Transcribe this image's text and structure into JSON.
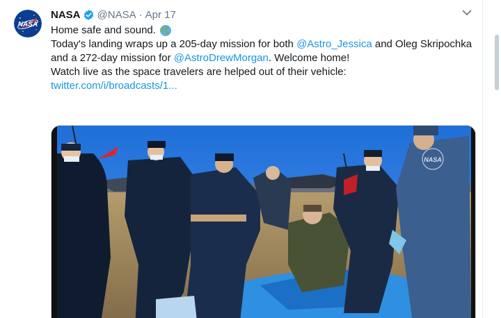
{
  "tweet": {
    "author": {
      "display_name": "NASA",
      "handle": "@NASA",
      "verified": true,
      "avatar_icon": "nasa-meatball-logo"
    },
    "separator": "·",
    "date": "Apr 17",
    "line1": "Home safe and sound.",
    "line1_emoji": "globe-icon",
    "paragraph2": {
      "t1": "Today's landing wraps up a 205-day mission for both ",
      "mention1": "@Astro_Jessica",
      "t2": " and Oleg Skripochka and a 272-day mission for ",
      "mention2": "@AstroDrewMorgan",
      "t3": ". Welcome home!"
    },
    "paragraph3": {
      "text": "Watch live as the space travelers are helped out of their vehicle:",
      "link": "twitter.com/i/broadcasts/1..."
    },
    "media": {
      "type": "video",
      "watermark": "NASA"
    }
  },
  "colors": {
    "link": "#1b95e0",
    "muted": "#657786",
    "verified": "#1da1f2",
    "nasa_blue": "#0b3d91",
    "nasa_red": "#fc3d21"
  }
}
